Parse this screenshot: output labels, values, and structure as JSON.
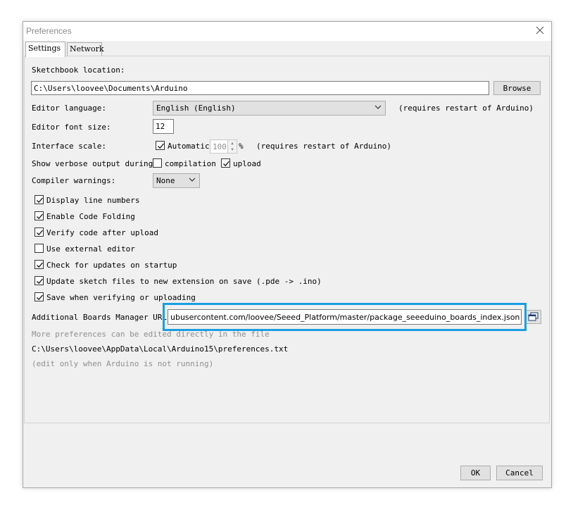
{
  "window": {
    "title": "Preferences"
  },
  "tabs": [
    {
      "label": "Settings"
    },
    {
      "label": "Network"
    }
  ],
  "settings": {
    "sketchbook_label": "Sketchbook location:",
    "sketchbook_value": "C:\\Users\\loovee\\Documents\\Arduino",
    "browse_label": "Browse",
    "editor_language_label": "Editor language:",
    "editor_language_value": "English (English)",
    "editor_language_note": "(requires restart of Arduino)",
    "font_size_label": "Editor font size:",
    "font_size_value": "12",
    "interface_scale_label": "Interface scale:",
    "automatic_label": "Automatic",
    "scale_value": "100",
    "scale_unit": "%",
    "scale_note": "(requires restart of Arduino)",
    "verbose_label": "Show verbose output during:",
    "compilation_label": "compilation",
    "upload_label": "upload",
    "compiler_warnings_label": "Compiler warnings:",
    "compiler_warnings_value": "None",
    "checkboxes": [
      {
        "label": "Display line numbers",
        "checked": true
      },
      {
        "label": "Enable Code Folding",
        "checked": true
      },
      {
        "label": "Verify code after upload",
        "checked": true
      },
      {
        "label": "Use external editor",
        "checked": false
      },
      {
        "label": "Check for updates on startup",
        "checked": true
      },
      {
        "label": "Update sketch files to new extension on save (.pde -> .ino)",
        "checked": true
      },
      {
        "label": "Save when verifying or uploading",
        "checked": true
      }
    ],
    "boards_urls_label": "Additional Boards Manager URLs:",
    "boards_urls_value": "ubusercontent.com/loovee/Seeed_Platform/master/package_seeeduino_boards_index.json",
    "more_prefs_text": "More preferences can be edited directly in the file",
    "prefs_path": "C:\\Users\\loovee\\AppData\\Local\\Arduino15\\preferences.txt",
    "edit_note": "(edit only when Arduino is not running)"
  },
  "footer": {
    "ok_label": "OK",
    "cancel_label": "Cancel"
  },
  "colors": {
    "highlight": "#1a9ee0",
    "window_bg": "#f0f0f0"
  },
  "icons": {
    "close": "close-icon",
    "url_editor": "window-icon",
    "dropdown": "chevron-down-icon"
  }
}
